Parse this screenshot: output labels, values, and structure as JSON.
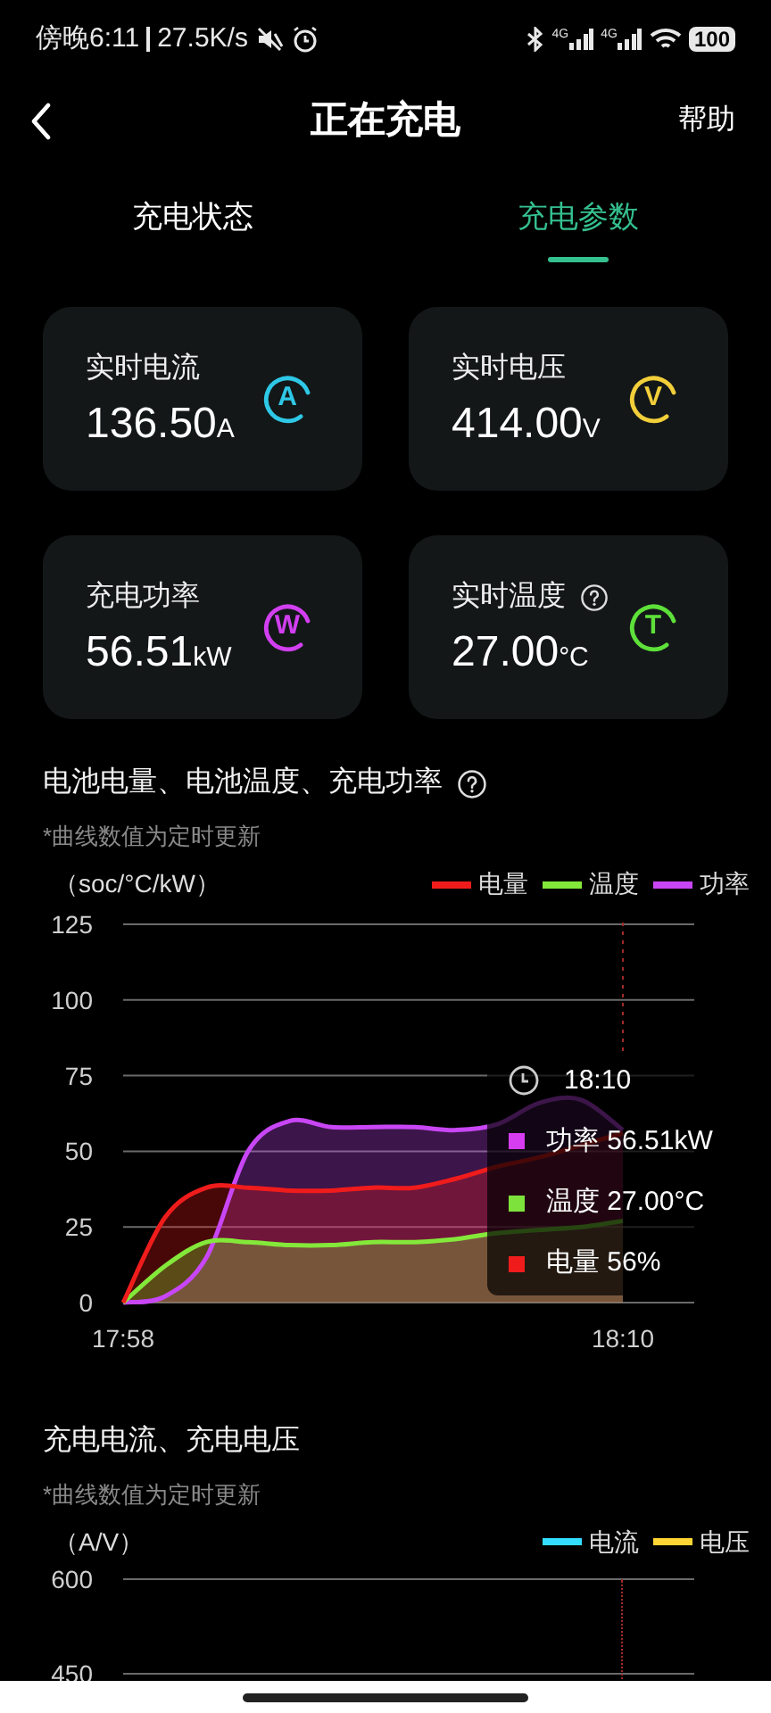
{
  "status_bar": {
    "time": "傍晚6:11",
    "speed": "27.5K/s",
    "network_1": "4G",
    "network_2": "4G",
    "battery": "100"
  },
  "header": {
    "title": "正在充电",
    "help": "帮助"
  },
  "tabs": [
    {
      "label": "充电状态",
      "selected": false
    },
    {
      "label": "充电参数",
      "selected": true
    }
  ],
  "metrics": [
    {
      "label": "实时电流",
      "value": "136.50",
      "unit": "A",
      "symbol": "A",
      "color": "#2ec8e6",
      "help": false
    },
    {
      "label": "实时电压",
      "value": "414.00",
      "unit": "V",
      "symbol": "V",
      "color": "#f2cf3a",
      "help": false
    },
    {
      "label": "充电功率",
      "value": "56.51",
      "unit": "kW",
      "symbol": "W",
      "color": "#d23ff0",
      "help": false
    },
    {
      "label": "实时温度",
      "value": "27.00",
      "unit": "°C",
      "symbol": "T",
      "color": "#5ee03a",
      "help": true
    }
  ],
  "charts": [
    {
      "title": "电池电量、电池温度、充电功率",
      "help": true,
      "note": "*曲线数值为定时更新",
      "chart_data": {
        "type": "area",
        "ylabel": "（soc/°C/kW）",
        "categories": [
          "17:58",
          null,
          null,
          null,
          null,
          null,
          null,
          null,
          null,
          null,
          null,
          null,
          "18:10"
        ],
        "ylim": [
          0,
          125
        ],
        "yticks": [
          0,
          25,
          50,
          75,
          100,
          125
        ],
        "grid": true,
        "ref_lines": [
          {
            "axis": "x",
            "value": "18:10"
          }
        ],
        "series": [
          {
            "name": "电量",
            "color": "#f01c1c",
            "values": [
              0,
              28,
              38,
              38,
              37,
              37,
              38,
              38,
              41,
              45,
              48,
              52,
              56
            ]
          },
          {
            "name": "温度",
            "color": "#84e83a",
            "values": [
              0,
              12,
              20,
              20,
              19,
              19,
              20,
              20,
              21,
              23,
              24,
              25,
              27
            ]
          },
          {
            "name": "功率",
            "color": "#c846f5",
            "values": [
              0,
              2,
              15,
              50,
              60,
              58,
              58,
              58,
              57,
              59,
              66,
              67,
              57
            ]
          }
        ]
      },
      "tooltip": {
        "time": "18:10",
        "items": [
          {
            "text": "功率 56.51kW",
            "color": "#d63cf0"
          },
          {
            "text": "温度 27.00°C",
            "color": "#7ee23c"
          },
          {
            "text": "电量 56%",
            "color": "#f01c1c"
          }
        ]
      }
    },
    {
      "title": "充电电流、充电电压",
      "help": false,
      "note": "*曲线数值为定时更新",
      "chart_data": {
        "type": "line",
        "ylabel": "（A/V）",
        "ylim": [
          450,
          600
        ],
        "yticks": [
          450,
          600
        ],
        "series": [
          {
            "name": "电流",
            "color": "#33ddff"
          },
          {
            "name": "电压",
            "color": "#ffd633"
          }
        ]
      }
    }
  ]
}
